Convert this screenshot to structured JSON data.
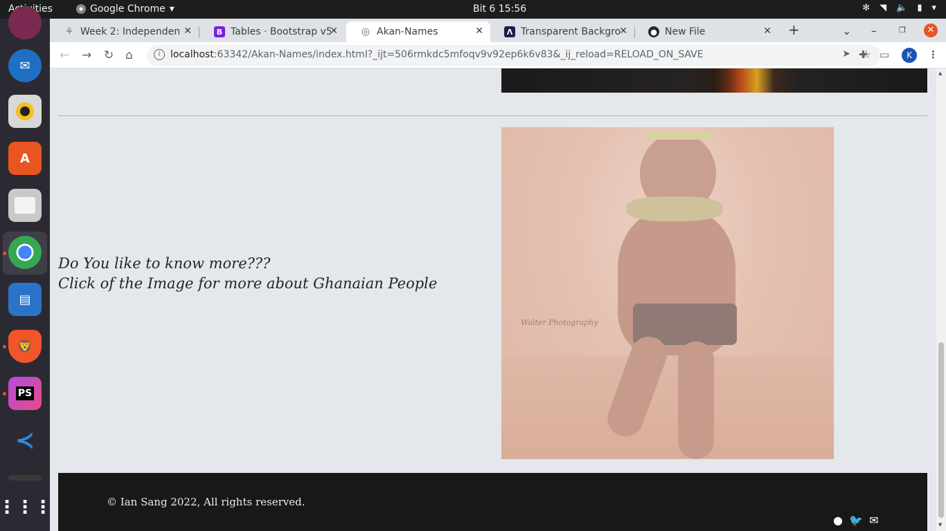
{
  "topbar": {
    "activities": "Activities",
    "app_name": "Google Chrome",
    "clock": "Bit 6  15:56"
  },
  "tabs": [
    {
      "title": "Week 2: Independent",
      "icon": "leaf-icon"
    },
    {
      "title": "Tables · Bootstrap v5",
      "icon": "bootstrap-icon"
    },
    {
      "title": "Akan-Names",
      "icon": "globe-icon",
      "active": true
    },
    {
      "title": "Transparent Backgro",
      "icon": "lambda-icon"
    },
    {
      "title": "New File",
      "icon": "github-icon"
    }
  ],
  "omnibox": {
    "host": "localhost",
    "rest": ":63342/Akan-Names/index.html?_ijt=506rmkdc5mfoqv9v92ep6k6v83&_ij_reload=RELOAD_ON_SAVE"
  },
  "profile_initial": "K",
  "page": {
    "cta_line1": "Do You like to know more???",
    "cta_line2": "Click of the Image for more about Ghanaian People",
    "photo_watermark": "Walter Photography",
    "footer_copyright": "© Ian Sang 2022, All rights reserved."
  },
  "colors": {
    "page_bg": "#e4e7eb",
    "footer_bg": "#181818",
    "ubuntu_accent": "#e95420"
  }
}
